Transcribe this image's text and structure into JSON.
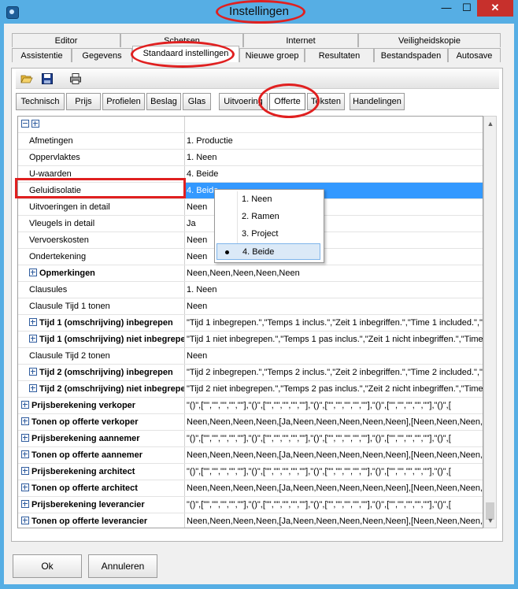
{
  "window": {
    "title": "Instellingen"
  },
  "title_controls": {
    "minimize": "—",
    "maximize": "☐",
    "close": "✕"
  },
  "tabs_top": [
    "Editor",
    "Schetsen",
    "Internet",
    "Veiligheidskopie"
  ],
  "tabs_bottom": [
    "Assistentie",
    "Gegevens",
    "Standaard instellingen",
    "Nieuwe groep",
    "Resultaten",
    "Bestandspaden",
    "Autosave"
  ],
  "active_tab": "Standaard instellingen",
  "toolbar": {
    "icons": [
      "open-folder-icon",
      "save-disk-icon",
      "print-icon"
    ]
  },
  "subtabs": [
    "Technisch",
    "Prijs",
    "Profielen",
    "Beslag",
    "Glas",
    "Uitvoering",
    "Offerte",
    "Teksten",
    "Handelingen"
  ],
  "active_subtab": "Offerte",
  "rows": [
    {
      "label": "Afmetingen",
      "value": "1. Productie"
    },
    {
      "label": "Oppervlaktes",
      "value": "1. Neen"
    },
    {
      "label": "U-waarden",
      "value": "4. Beide"
    },
    {
      "label": "Geluidisolatie",
      "value": "4. Beide"
    },
    {
      "label": "Uitvoeringen in detail",
      "value": "Neen"
    },
    {
      "label": "Vleugels in detail",
      "value": "Ja"
    },
    {
      "label": "Vervoerskosten",
      "value": "Neen"
    },
    {
      "label": "Ondertekening",
      "value": "Neen"
    },
    {
      "label": "Opmerkingen",
      "value": "Neen,Neen,Neen,Neen,Neen"
    },
    {
      "label": "Clausules",
      "value": "1. Neen"
    },
    {
      "label": "Clausule Tijd 1 tonen",
      "value": "Neen"
    },
    {
      "label": "Tijd 1 (omschrijving) inbegrepen",
      "value": "\"Tijd 1 inbegrepen.\",\"Temps 1 inclus.\",\"Zeit 1 inbegriffen.\",\"Time 1 included.\",\""
    },
    {
      "label": "Tijd 1 (omschrijving) niet inbegrepen",
      "value": "\"Tijd 1 niet inbegrepen.\",\"Temps 1 pas inclus.\",\"Zeit 1 nicht inbegriffen.\",\"Time"
    },
    {
      "label": "Clausule Tijd 2 tonen",
      "value": "Neen"
    },
    {
      "label": "Tijd 2 (omschrijving) inbegrepen",
      "value": "\"Tijd 2 inbegrepen.\",\"Temps 2 inclus.\",\"Zeit 2 inbegriffen.\",\"Time 2 included.\",\""
    },
    {
      "label": "Tijd 2 (omschrijving) niet inbegrepen",
      "value": "\"Tijd 2 niet inbegrepen.\",\"Temps 2 pas inclus.\",\"Zeit 2 nicht inbegriffen.\",\"Time"
    },
    {
      "label": "Prijsberekening verkoper",
      "value": "\"()\",[\"\",\"\",\"\",\"\",\"\"],\"()\",[\"\",\"\",\"\",\"\",\"\"],\"()\",[\"\",\"\",\"\",\"\",\"\"],\"()\",[\"\",\"\",\"\",\"\",\"\"],\"()\",["
    },
    {
      "label": "Tonen op offerte verkoper",
      "value": "Neen,Neen,Neen,Neen,[Ja,Neen,Neen,Neen,Neen,Neen],[Neen,Neen,Neen,N"
    },
    {
      "label": "Prijsberekening aannemer",
      "value": "\"()\",[\"\",\"\",\"\",\"\",\"\"],\"()\",[\"\",\"\",\"\",\"\",\"\"],\"()\",[\"\",\"\",\"\",\"\",\"\"],\"()\",[\"\",\"\",\"\",\"\",\"\"],\"()\",["
    },
    {
      "label": "Tonen op offerte aannemer",
      "value": "Neen,Neen,Neen,Neen,[Ja,Neen,Neen,Neen,Neen,Neen],[Neen,Neen,Neen,N"
    },
    {
      "label": "Prijsberekening architect",
      "value": "\"()\",[\"\",\"\",\"\",\"\",\"\"],\"()\",[\"\",\"\",\"\",\"\",\"\"],\"()\",[\"\",\"\",\"\",\"\",\"\"],\"()\",[\"\",\"\",\"\",\"\",\"\"],\"()\",["
    },
    {
      "label": "Tonen op offerte architect",
      "value": "Neen,Neen,Neen,Neen,[Ja,Neen,Neen,Neen,Neen,Neen],[Neen,Neen,Neen,N"
    },
    {
      "label": "Prijsberekening leverancier",
      "value": "\"()\",[\"\",\"\",\"\",\"\",\"\"],\"()\",[\"\",\"\",\"\",\"\",\"\"],\"()\",[\"\",\"\",\"\",\"\",\"\"],\"()\",[\"\",\"\",\"\",\"\",\"\"],\"()\",["
    },
    {
      "label": "Tonen op offerte leverancier",
      "value": "Neen,Neen,Neen,Neen,[Ja,Neen,Neen,Neen,Neen,Neen],[Neen,Neen,Neen,N"
    }
  ],
  "selected_row": "Geluidisolatie",
  "dropdown": {
    "options": [
      "1. Neen",
      "2. Ramen",
      "3. Project",
      "4. Beide"
    ],
    "selected": "4. Beide"
  },
  "buttons": {
    "ok": "Ok",
    "cancel": "Annuleren"
  }
}
